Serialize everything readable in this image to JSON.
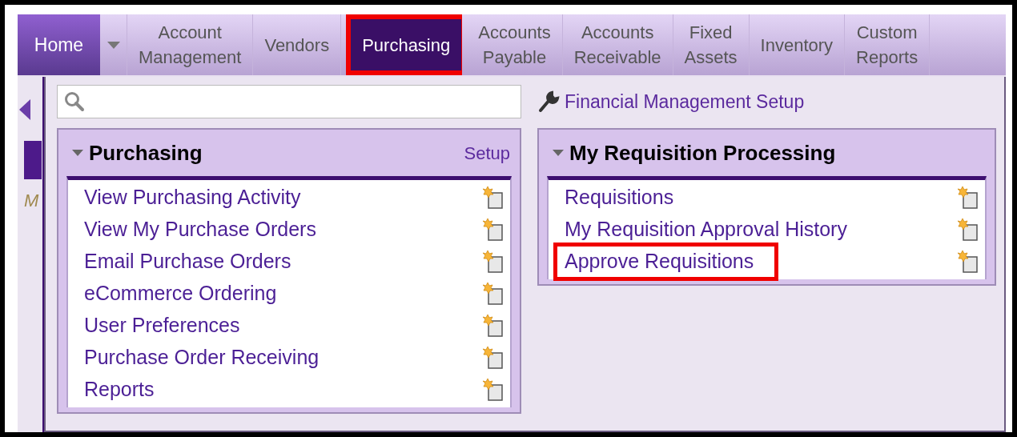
{
  "nav": {
    "home": {
      "label": "Home",
      "selected": false
    },
    "tabs": [
      {
        "label": "Account\nManagement",
        "selected": false,
        "highlighted": false
      },
      {
        "label": "Vendors",
        "selected": false,
        "highlighted": false
      },
      {
        "label": "Purchasing",
        "selected": true,
        "highlighted": true
      },
      {
        "label": "Accounts\nPayable",
        "selected": false,
        "highlighted": false
      },
      {
        "label": "Accounts\nReceivable",
        "selected": false,
        "highlighted": false
      },
      {
        "label": "Fixed\nAssets",
        "selected": false,
        "highlighted": false
      },
      {
        "label": "Inventory",
        "selected": false,
        "highlighted": false
      },
      {
        "label": "Custom\nReports",
        "selected": false,
        "highlighted": false
      }
    ]
  },
  "background_fragment": "M",
  "menu": {
    "setup_link": "Financial Management Setup",
    "sections": [
      {
        "title": "Purchasing",
        "expanded": true,
        "action": "Setup",
        "items": [
          {
            "label": "View Purchasing Activity",
            "highlighted": false
          },
          {
            "label": "View My Purchase Orders",
            "highlighted": false
          },
          {
            "label": "Email Purchase Orders",
            "highlighted": false
          },
          {
            "label": "eCommerce Ordering",
            "highlighted": false
          },
          {
            "label": "User Preferences",
            "highlighted": false
          },
          {
            "label": "Purchase Order Receiving",
            "highlighted": false
          },
          {
            "label": "Reports",
            "highlighted": false
          }
        ]
      },
      {
        "title": "My Requisition Processing",
        "expanded": true,
        "items": [
          {
            "label": "Requisitions",
            "highlighted": false
          },
          {
            "label": "My Requisition Approval History",
            "highlighted": false
          },
          {
            "label": "Approve Requisitions",
            "highlighted": true
          }
        ]
      }
    ]
  }
}
